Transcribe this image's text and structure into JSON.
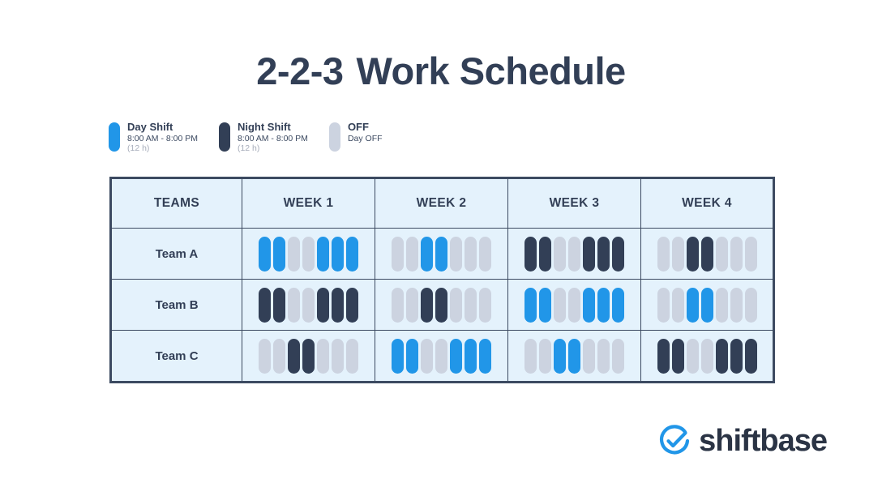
{
  "title": {
    "prefix": "2-2-3",
    "main": "Work Schedule"
  },
  "legend": {
    "items": [
      {
        "key": "day",
        "label": "Day Shift",
        "time": "8:00 AM - 8:00 PM",
        "hours": "(12 h)",
        "color": "#2196e8",
        "swatch_name": "legend-swatch-day"
      },
      {
        "key": "night",
        "label": "Night Shift",
        "time": "8:00 AM - 8:00 PM",
        "hours": "(12 h)",
        "color": "#323f56",
        "swatch_name": "legend-swatch-night"
      },
      {
        "key": "off",
        "label": "OFF",
        "time": "Day OFF",
        "hours": "",
        "color": "#ccd3e0",
        "swatch_name": "legend-swatch-off"
      }
    ]
  },
  "table": {
    "headers": [
      "TEAMS",
      "WEEK 1",
      "WEEK 2",
      "WEEK 3",
      "WEEK 4"
    ],
    "rows": [
      {
        "team": "Team A",
        "weeks": [
          [
            "day",
            "day",
            "off",
            "off",
            "day",
            "day",
            "day"
          ],
          [
            "off",
            "off",
            "day",
            "day",
            "off",
            "off",
            "off"
          ],
          [
            "night",
            "night",
            "off",
            "off",
            "night",
            "night",
            "night"
          ],
          [
            "off",
            "off",
            "night",
            "night",
            "off",
            "off",
            "off"
          ]
        ]
      },
      {
        "team": "Team B",
        "weeks": [
          [
            "night",
            "night",
            "off",
            "off",
            "night",
            "night",
            "night"
          ],
          [
            "off",
            "off",
            "night",
            "night",
            "off",
            "off",
            "off"
          ],
          [
            "day",
            "day",
            "off",
            "off",
            "day",
            "day",
            "day"
          ],
          [
            "off",
            "off",
            "day",
            "day",
            "off",
            "off",
            "off"
          ]
        ]
      },
      {
        "team": "Team C",
        "weeks": [
          [
            "off",
            "off",
            "night",
            "night",
            "off",
            "off",
            "off"
          ],
          [
            "day",
            "day",
            "off",
            "off",
            "day",
            "day",
            "day"
          ],
          [
            "off",
            "off",
            "day",
            "day",
            "off",
            "off",
            "off"
          ],
          [
            "night",
            "night",
            "off",
            "off",
            "night",
            "night",
            "night"
          ]
        ]
      }
    ]
  },
  "logo": {
    "word": "shiftbase",
    "mark_name": "shiftbase-check-circle-icon",
    "mark_color": "#2196e8",
    "word_color": "#2b3445"
  },
  "colors": {
    "day": "#2196e8",
    "night": "#323f56",
    "off": "#ccd3e0",
    "cell_bg": "#e4f2fc",
    "border": "#3c4a61",
    "text": "#323f56",
    "background": "#ffffff"
  }
}
